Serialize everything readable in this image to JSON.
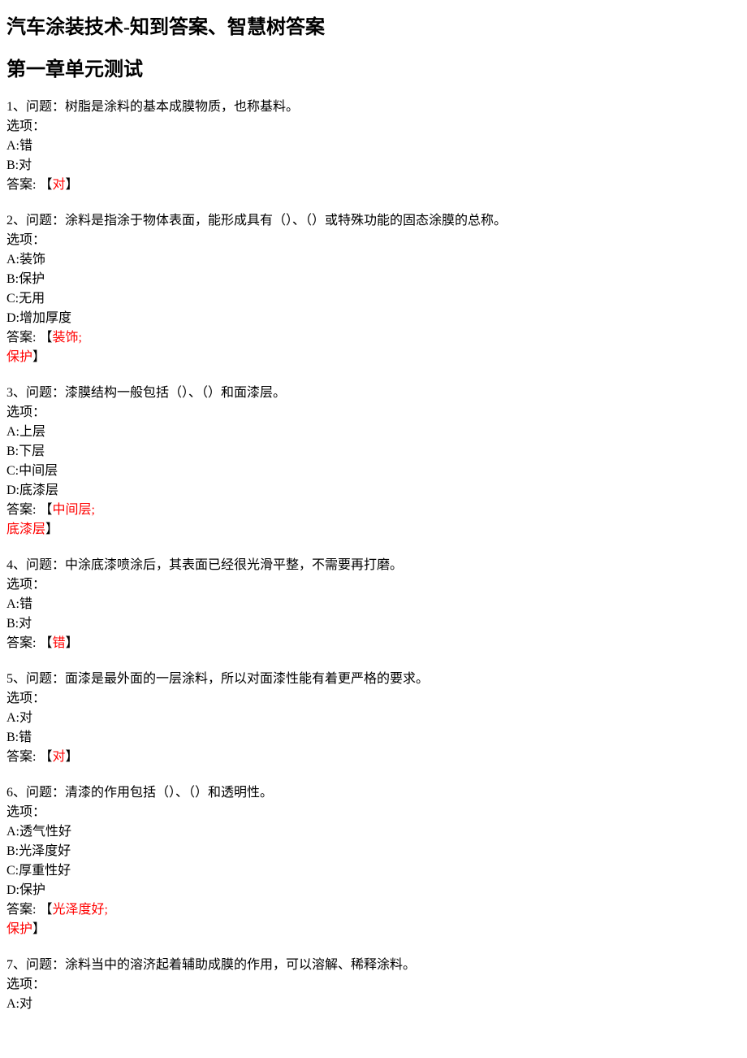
{
  "title": "汽车涂装技术-知到答案、智慧树答案",
  "chapter": "第一章单元测试",
  "labels": {
    "options_label": "选项：",
    "answer_label": "答案: 【",
    "answer_close": "】"
  },
  "questions": [
    {
      "num": "1",
      "text": "、问题：树脂是涂料的基本成膜物质，也称基料。",
      "options": [
        "A:错",
        "B:对"
      ],
      "answers": [
        "对"
      ]
    },
    {
      "num": "2",
      "text": "、问题：涂料是指涂于物体表面，能形成具有（）、（）或特殊功能的固态涂膜的总称。",
      "options": [
        "A:装饰",
        "B:保护",
        "C:无用",
        "D:增加厚度"
      ],
      "answers": [
        "装饰;",
        "保护"
      ]
    },
    {
      "num": "3",
      "text": "、问题：漆膜结构一般包括（）、（）和面漆层。",
      "options": [
        "A:上层",
        "B:下层",
        "C:中间层",
        "D:底漆层"
      ],
      "answers": [
        "中间层;",
        "底漆层"
      ]
    },
    {
      "num": "4",
      "text": "、问题：中涂底漆喷涂后，其表面已经很光滑平整，不需要再打磨。",
      "options": [
        "A:错",
        "B:对"
      ],
      "answers": [
        "错"
      ]
    },
    {
      "num": "5",
      "text": "、问题：面漆是最外面的一层涂料，所以对面漆性能有着更严格的要求。",
      "options": [
        "A:对",
        "B:错"
      ],
      "answers": [
        "对"
      ]
    },
    {
      "num": "6",
      "text": "、问题：清漆的作用包括（）、（）和透明性。",
      "options": [
        "A:透气性好",
        "B:光泽度好",
        "C:厚重性好",
        "D:保护"
      ],
      "answers": [
        "光泽度好;",
        "保护"
      ]
    },
    {
      "num": "7",
      "text": "、问题：涂料当中的溶济起着辅助成膜的作用，可以溶解、稀释涂料。",
      "options": [
        "A:对"
      ],
      "answers": []
    }
  ]
}
